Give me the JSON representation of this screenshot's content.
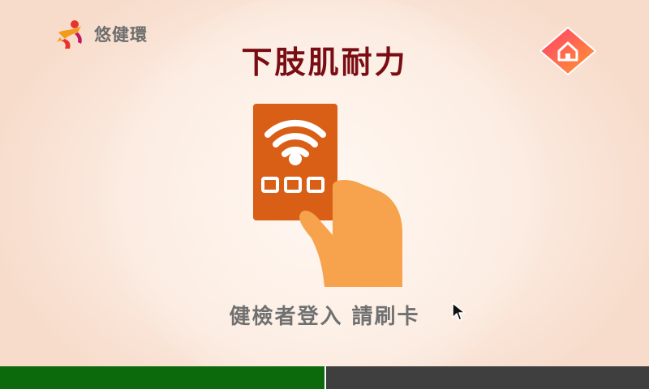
{
  "brand": {
    "name": "悠健環",
    "logo_icon": "person-star-logo-icon"
  },
  "page": {
    "title": "下肢肌耐力"
  },
  "home_button": {
    "icon": "home-icon",
    "gradient_start": "#ff3d6e",
    "gradient_end": "#ff9a2e"
  },
  "illustration": {
    "icon": "rfid-card-tap-icon",
    "card_color": "#d95f17",
    "hand_color": "#f7a24c"
  },
  "prompt": {
    "text": "健檢者登入 請刷卡"
  },
  "status_bar": {
    "left_color": "#0c6a0c",
    "right_color": "#3f3f3f"
  },
  "colors": {
    "title": "#7a0d14",
    "prompt": "#707070",
    "background": "#fbe9dd"
  }
}
